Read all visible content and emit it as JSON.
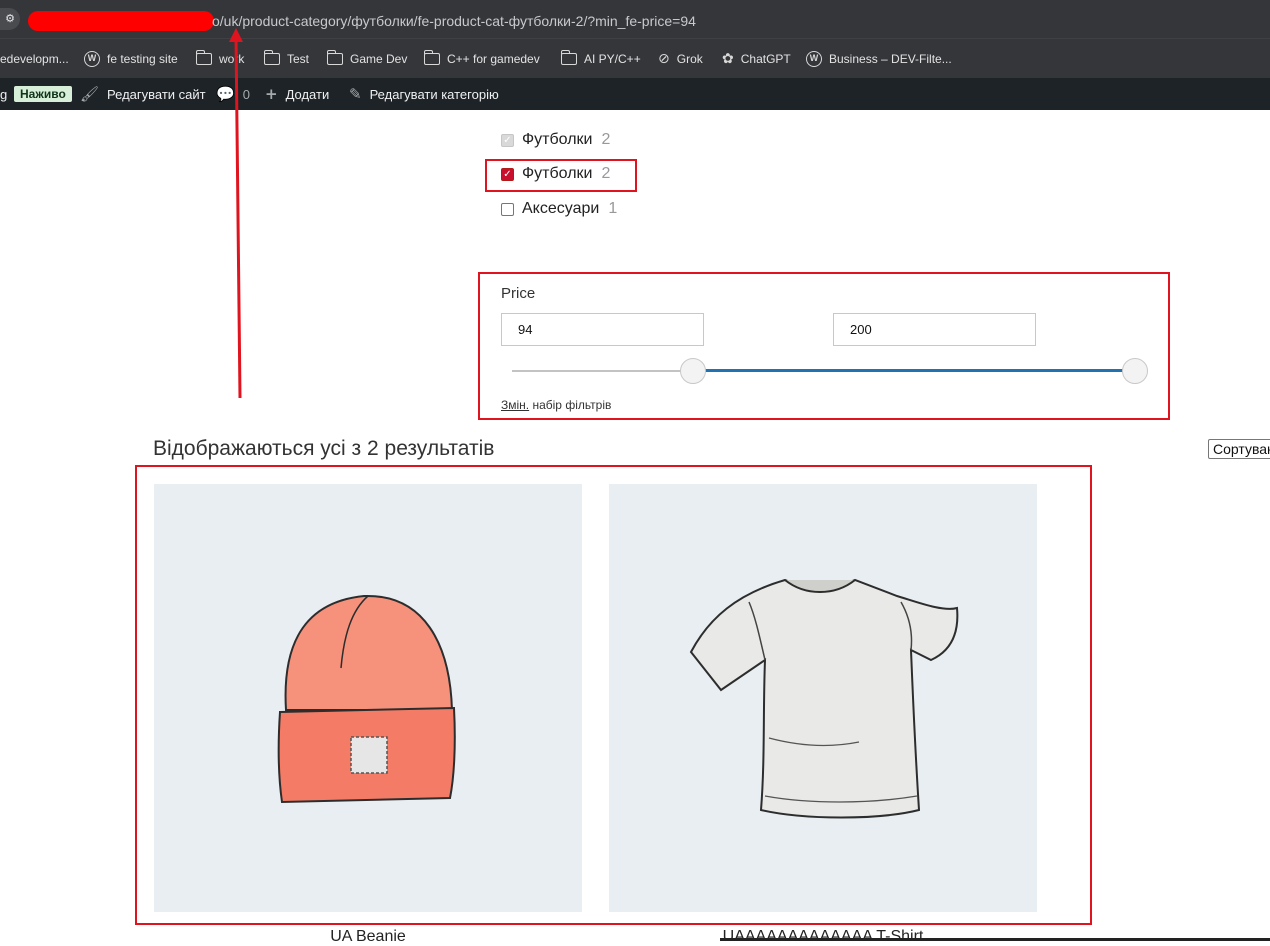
{
  "browser": {
    "site_settings_icon": "tune-icon",
    "url_visible": "o/uk/product-category/футболки/fe-product-cat-футболки-2/?min_fe-price=94"
  },
  "bookmarks": [
    {
      "label": "edevelopm...",
      "icon": "none"
    },
    {
      "label": "fe testing site",
      "icon": "wordpress-icon"
    },
    {
      "label": "work",
      "icon": "folder-icon"
    },
    {
      "label": "Test",
      "icon": "folder-icon"
    },
    {
      "label": "Game Dev",
      "icon": "folder-icon"
    },
    {
      "label": "C++ for gamedev",
      "icon": "folder-icon"
    },
    {
      "label": "AI PY/C++",
      "icon": "folder-icon"
    },
    {
      "label": "Grok",
      "icon": "grok-icon"
    },
    {
      "label": "ChatGPT",
      "icon": "chatgpt-icon"
    },
    {
      "label": "Business – DEV-Filte...",
      "icon": "wordpress-icon"
    }
  ],
  "admin_bar": {
    "cut_label": "g",
    "live_badge": "Наживо",
    "edit_site": "Редагувати сайт",
    "comments_count": "0",
    "add_new": "Додати",
    "edit_category": "Редагувати категорію"
  },
  "filters": {
    "categories": [
      {
        "label": "Футболки",
        "count": "2",
        "state": "disabled"
      },
      {
        "label": "Футболки",
        "count": "2",
        "state": "checked"
      },
      {
        "label": "Аксесуари",
        "count": "1",
        "state": "unchecked"
      }
    ],
    "price": {
      "title": "Price",
      "min_value": "94",
      "max_value": "200",
      "range_min_fraction": 0.29,
      "range_max_fraction": 1.0
    },
    "reset_link": "Змін.",
    "reset_text": "набір фільтрів"
  },
  "results": {
    "count_text": "Відображаються усі з 2 результатів",
    "sort_label": "Сортування"
  },
  "products": [
    {
      "title": "UA Beanie",
      "image": "beanie-illustration"
    },
    {
      "title": "UAAAAAAAAAAAAA T-Shirt",
      "image": "tshirt-illustration"
    }
  ],
  "annotations": {
    "color": "#e0141e"
  }
}
